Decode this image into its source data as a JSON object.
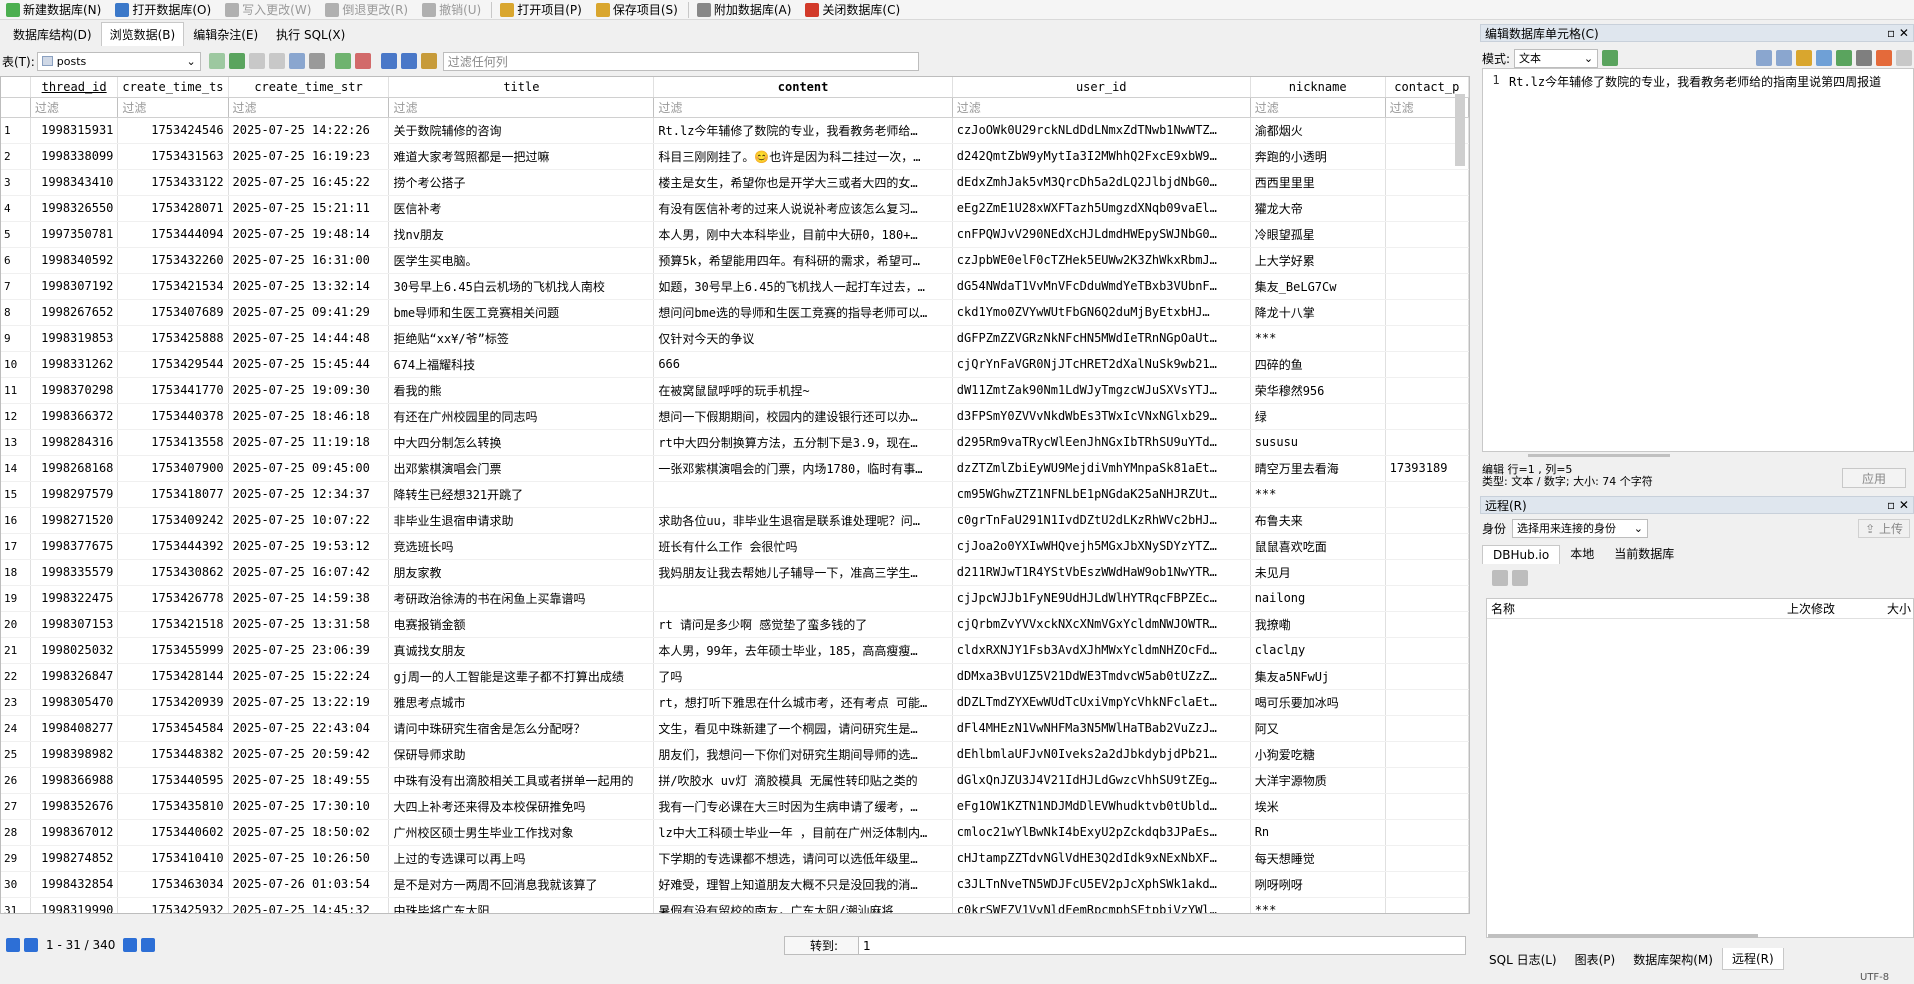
{
  "toolbar": [
    {
      "id": "new-db",
      "label": "新建数据库(N)",
      "icon": "new-db-icon",
      "color": "#4caf50",
      "enabled": true
    },
    {
      "id": "open-db",
      "label": "打开数据库(O)",
      "icon": "open-db-icon",
      "color": "#3b78c9",
      "enabled": true
    },
    {
      "id": "write-changes",
      "label": "写入更改(W)",
      "icon": "write-icon",
      "color": "#b0b0b0",
      "enabled": false
    },
    {
      "id": "revert-changes",
      "label": "倒退更改(R)",
      "icon": "revert-icon",
      "color": "#b0b0b0",
      "enabled": false
    },
    {
      "id": "undo",
      "label": "撤销(U)",
      "icon": "undo-icon",
      "color": "#b0b0b0",
      "enabled": false
    },
    {
      "id": "open-project",
      "label": "打开项目(P)",
      "icon": "open-project-icon",
      "color": "#d9a62e",
      "enabled": true
    },
    {
      "id": "save-project",
      "label": "保存项目(S)",
      "icon": "save-project-icon",
      "color": "#d9a62e",
      "enabled": true
    },
    {
      "id": "attach-db",
      "label": "附加数据库(A)",
      "icon": "attach-db-icon",
      "color": "#888888",
      "enabled": true
    },
    {
      "id": "close-db",
      "label": "关闭数据库(C)",
      "icon": "close-db-icon",
      "color": "#d23a2a",
      "enabled": true
    }
  ],
  "tabs": [
    "数据库结构(D)",
    "浏览数据(B)",
    "编辑杂注(E)",
    "执行 SQL(X)"
  ],
  "active_tab": 1,
  "table_label": "表(T):",
  "table_name": "posts",
  "filter_all_placeholder": "过滤任何列",
  "filter_placeholder": "过滤",
  "columns": [
    "thread_id",
    "create_time_ts",
    "create_time_str",
    "title",
    "content",
    "user_id",
    "nickname",
    "contact_p"
  ],
  "rows": [
    [
      "1998315931",
      "1753424546",
      "2025-07-25 14:22:26",
      "关于数院辅修的咨询",
      "Rt.lz今年辅修了数院的专业，我看教务老师给…",
      "czJoOWk0U29rckNLdDdLNmxZdTNwb1NwWTZ…",
      "渝都烟火",
      ""
    ],
    [
      "1998338099",
      "1753431563",
      "2025-07-25 16:19:23",
      "难道大家考驾照都是一把过嘛",
      "科目三刚刚挂了。😊也许是因为科二挂过一次，…",
      "d242QmtZbW9yMytIa3I2MWhhQ2FxcE9xbW9…",
      "奔跑的小透明",
      ""
    ],
    [
      "1998343410",
      "1753433122",
      "2025-07-25 16:45:22",
      "捞个考公搭子",
      "楼主是女生，希望你也是开学大三或者大四的女…",
      "dEdxZmhJak5vM3QrcDh5a2dLQ2JlbjdNbG0…",
      "西西里里里",
      ""
    ],
    [
      "1998326550",
      "1753428071",
      "2025-07-25 15:21:11",
      "医信补考",
      "有没有医信补考的过来人说说补考应该怎么复习…",
      "eEg2ZmE1U28xWXFTazh5UmgzdXNqb09vaEl…",
      "獾龙大帝",
      ""
    ],
    [
      "1997350781",
      "1753444094",
      "2025-07-25 19:48:14",
      "找nv朋友",
      "本人男，刚中大本科毕业，目前中大研0，180+…",
      "cnFPQWJvV290NEdXcHJLdmdHWEpySWJNbG0…",
      "冷眼望孤星",
      ""
    ],
    [
      "1998340592",
      "1753432260",
      "2025-07-25 16:31:00",
      "医学生买电脑。",
      "预算5k，希望能用四年。有科研的需求，希望可…",
      "czJpbWE0elF0cTZHek5EUWw2K3ZhWkxRbmJ…",
      "上大学好累",
      ""
    ],
    [
      "1998307192",
      "1753421534",
      "2025-07-25 13:32:14",
      "30号早上6.45白云机场的飞机找人南校",
      "如题，30号早上6.45的飞机找人一起打车过去，…",
      "dG54NWdaT1VvMnVFcDduWmdYeTBxb3VUbnF…",
      "集友_BeLG7Cw",
      ""
    ],
    [
      "1998267652",
      "1753407689",
      "2025-07-25 09:41:29",
      "bme导师和生医工竞赛相关问题",
      "想问问bme选的导师和生医工竞赛的指导老师可以…",
      "ckd1Ymo0ZVYwWUtFbGN6Q2duMjByEtxbHJ…",
      "降龙十八掌",
      ""
    ],
    [
      "1998319853",
      "1753425888",
      "2025-07-25 14:44:48",
      "拒绝贴“xx¥/爷”标签",
      "仅针对今天的争议",
      "dGFPZmZZVGRzNkNFcHN5MWdIeTRnNGpOaUt…",
      "***",
      ""
    ],
    [
      "1998331262",
      "1753429544",
      "2025-07-25 15:45:44",
      "674上福耀科技",
      "666",
      "cjQrYnFaVGR0NjJTcHRET2dXalNuSk9wb21…",
      "四碎的鱼",
      ""
    ],
    [
      "1998370298",
      "1753441770",
      "2025-07-25 19:09:30",
      "看我的熊",
      "在被窝鼠鼠呼呼的玩手机捏~",
      "dW11ZmtZak90Nm1LdWJyTmgzcWJuSXVsYTJ…",
      "荣华穆然956",
      ""
    ],
    [
      "1998366372",
      "1753440378",
      "2025-07-25 18:46:18",
      "有还在广州校园里的同志吗",
      "想问一下假期期间，校园内的建设银行还可以办…",
      "d3FPSmY0ZVVvNkdWbEs3TWxIcVNxNGlxb29…",
      "绿",
      ""
    ],
    [
      "1998284316",
      "1753413558",
      "2025-07-25 11:19:18",
      "中大四分制怎么转换",
      "rt中大四分制换算方法，五分制下是3.9，现在…",
      "d295Rm9vaTRycWlEenJhNGxIbTRhSU9uYTd…",
      "sususu",
      ""
    ],
    [
      "1998268168",
      "1753407900",
      "2025-07-25 09:45:00",
      "出邓紫棋演唱会门票",
      "一张邓紫棋演唱会的门票，内场1780，临时有事…",
      "dzZTZmlZbiEyWU9MejdiVmhYMnpaSk81aEt…",
      "晴空万里去看海",
      "17393189"
    ],
    [
      "1998297579",
      "1753418077",
      "2025-07-25 12:34:37",
      "降转生已经想321开跳了",
      "",
      "cm95WGhwZTZ1NFNLbE1pNGdaK25aNHJRZUt…",
      "***",
      ""
    ],
    [
      "1998271520",
      "1753409242",
      "2025-07-25 10:07:22",
      "非毕业生退宿申请求助",
      "求助各位uu，非毕业生退宿是联系谁处理呢？问…",
      "c0grTnFaU291N1IvdDZtU2dLKzRhWVc2bHJ…",
      "布鲁夫来",
      ""
    ],
    [
      "1998377675",
      "1753444392",
      "2025-07-25 19:53:12",
      "竞选班长吗",
      "班长有什么工作 会很忙吗",
      "cjJoa2o0YXIwWHQvejh5MGxJbXNySDYzYTZ…",
      "鼠鼠喜欢吃面",
      ""
    ],
    [
      "1998335579",
      "1753430862",
      "2025-07-25 16:07:42",
      "朋友家教",
      "我妈朋友让我去帮她儿子辅导一下，准高三学生…",
      "d211RWJwT1R4YStVbEszWWdHaW9ob1NwYTR…",
      "未见月",
      ""
    ],
    [
      "1998322475",
      "1753426778",
      "2025-07-25 14:59:38",
      "考研政治徐涛的书在闲鱼上买靠谱吗",
      "",
      "cjJpcWJJb1FyNE9UdHJLdWlHYTRqcFBPZEc…",
      "nailong",
      ""
    ],
    [
      "1998307153",
      "1753421518",
      "2025-07-25 13:31:58",
      "电赛报销金额",
      "rt 请问是多少啊 感觉垫了蛮多钱的了",
      "cjQrbmZvYVVxckNXcXNmVGxYcldmNWJOWTR…",
      "我撩嘞",
      ""
    ],
    [
      "1998025032",
      "1753455999",
      "2025-07-25 23:06:39",
      "真诚找女朋友",
      "本人男，99年，去年硕士毕业，185，高高瘦瘦…",
      "cldxRXNJY1Fsb3AvdXJhMWxYcldmNHZOcFd…",
      "claclдy",
      ""
    ],
    [
      "1998326847",
      "1753428144",
      "2025-07-25 15:22:24",
      "gj周一的人工智能是这辈子都不打算出成绩",
      "了吗",
      "dDMxa3BvU1Z5V21DdWE3TmdvcW5ab0tUZzZ…",
      "集友a5NFwUj",
      ""
    ],
    [
      "1998305470",
      "1753420939",
      "2025-07-25 13:22:19",
      "雅思考点城市",
      "rt，想打听下雅思在什么城市考，还有考点 可能…",
      "dDZLTmdZYXEwWUdTcUxiVmpYcVhkNFclaEt…",
      "喝可乐要加冰吗",
      ""
    ],
    [
      "1998408277",
      "1753454584",
      "2025-07-25 22:43:04",
      "请问中珠研究生宿舍是怎么分配呀？",
      "文生，看见中珠新建了一个桐园，请问研究生是…",
      "dFl4MHEzN1VwNHFMa3N5MWlHaTBab2VuZzJ…",
      "阿又",
      ""
    ],
    [
      "1998398982",
      "1753448382",
      "2025-07-25 20:59:42",
      "保研导师求助",
      "朋友们，我想问一下你们对研究生期间导师的选…",
      "dEhlbmlaUFJvN0Iveks2a2dJbkdybjdPb21…",
      "小狗爱吃糖",
      ""
    ],
    [
      "1998366988",
      "1753440595",
      "2025-07-25 18:49:55",
      "中珠有没有出滴胶相关工具或者拼单一起用的",
      "拼/吹胶水 uv灯 滴胶模具 无属性转印贴之类的",
      "dGlxQnJZU3J4V21IdHJLdGwzcVhhSU9tZEg…",
      "大洋宇源物质",
      ""
    ],
    [
      "1998352676",
      "1753435810",
      "2025-07-25 17:30:10",
      "大四上补考还来得及本校保研推免吗",
      "我有一门专必课在大三时因为生病申请了缓考，…",
      "eFg1OW1KZTN1NDJMdDlEVWhudktvb0tUbld…",
      "埃米",
      ""
    ],
    [
      "1998367012",
      "1753440602",
      "2025-07-25 18:50:02",
      "广州校区硕士男生毕业工作找对象",
      "lz中大工科硕士毕业一年 ，目前在广州泛体制内…",
      "cmloc21wYlBwNkI4bExyU2pZckdqb3JPaEs…",
      "Rn",
      ""
    ],
    [
      "1998274852",
      "1753410410",
      "2025-07-25 10:26:50",
      "上过的专选课可以再上吗",
      "下学期的专选课都不想选，请问可以选低年级里…",
      "cHJtampZZTdvNGlVdHE3Q2dIdk9xNExNbXF…",
      "每天想睡觉",
      ""
    ],
    [
      "1998432854",
      "1753463034",
      "2025-07-26 01:03:54",
      "是不是对方一两周不回消息我就该算了",
      "好难受，理智上知道朋友大概不只是没回我的消…",
      "c3JLTnNveTN5WDJFcU5EV2pJcXphSWk1akd…",
      "咧呀咧呀",
      ""
    ],
    [
      "1998319990",
      "1753425932",
      "2025-07-25 14:45:32",
      "中珠毕将广东太阳",
      "暑假有没有留校的南友，广东太阳/潮汕麻将…",
      "c0krSWFZV1VvNldFemRpcmphSFtpbjVzYWl…",
      "***",
      ""
    ]
  ],
  "pagination": {
    "range": "1 - 31 / 340",
    "goto_label": "转到:",
    "goto_value": "1"
  },
  "cell_editor": {
    "title": "编辑数据库单元格(C)",
    "mode_label": "模式:",
    "mode_value": "文本",
    "line_no": "1",
    "content": "Rt.lz今年辅修了数院的专业，我看教务老师给的指南里说第四周报道",
    "status_pos": "编辑 行=1 , 列=5",
    "status_type": "类型: 文本 / 数字; 大小: 74 个字符",
    "apply_label": "应用"
  },
  "remote": {
    "title": "远程(R)",
    "identity_label": "身份",
    "identity_value": "选择用来连接的身份",
    "upload_label": "上传",
    "tabs": [
      "DBHub.io",
      "本地",
      "当前数据库"
    ],
    "active_tab": 0,
    "col_name": "名称",
    "col_modified": "上次修改",
    "col_size": "大小"
  },
  "bottom_tabs": [
    "SQL 日志(L)",
    "图表(P)",
    "数据库架构(M)",
    "远程(R)"
  ],
  "bottom_active": 3,
  "encoding": "UTF-8"
}
